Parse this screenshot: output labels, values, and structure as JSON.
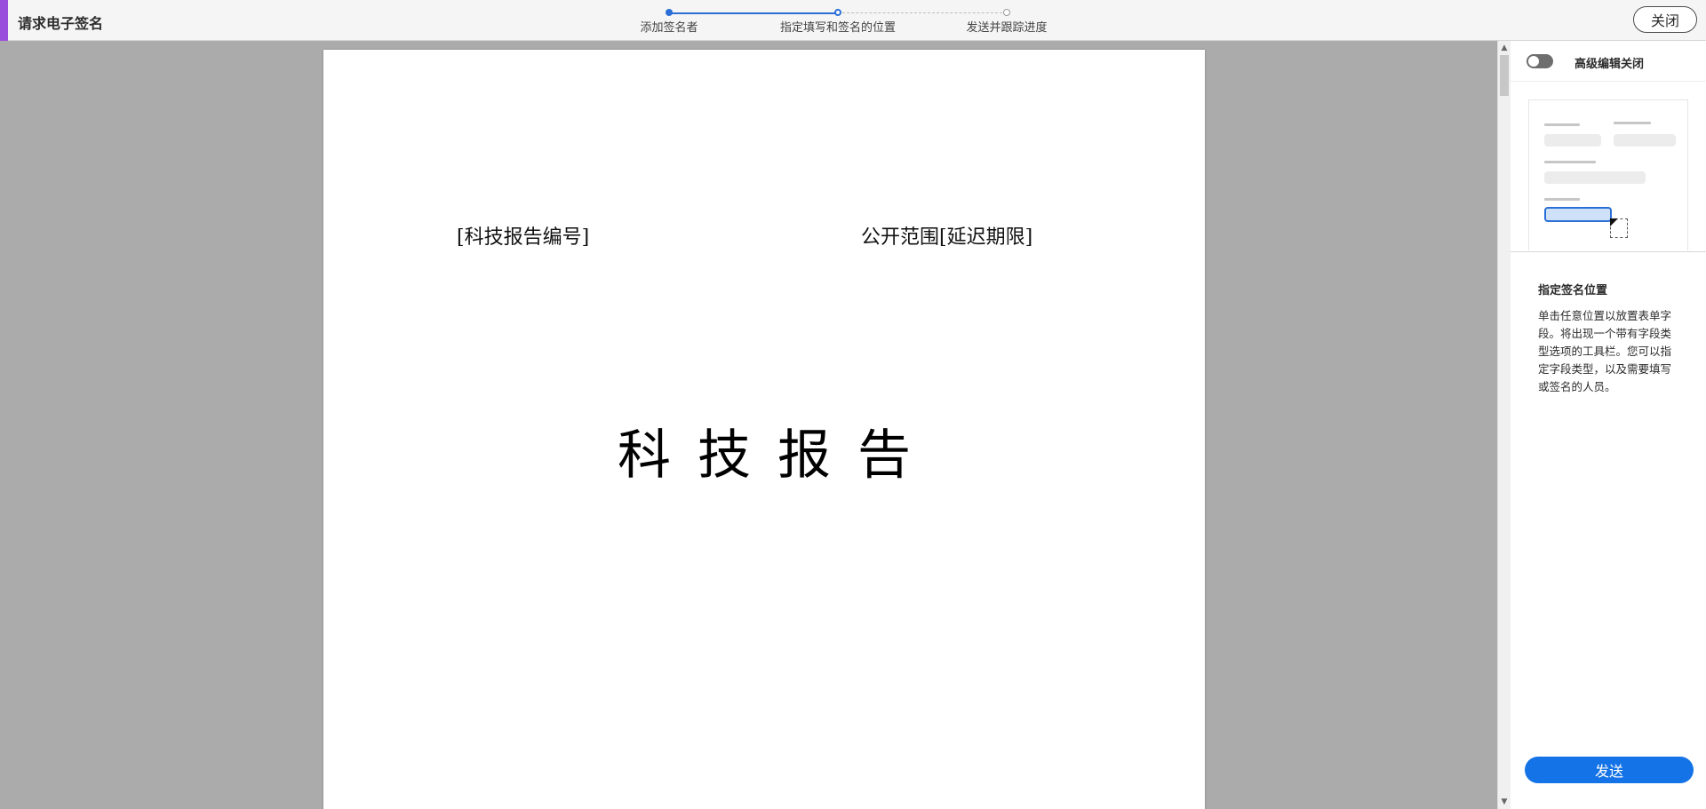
{
  "app": {
    "title": "请求电子签名",
    "accent_color": "#9a4fdc"
  },
  "stepper": {
    "steps": [
      {
        "label": "添加签名者",
        "status": "completed"
      },
      {
        "label": "指定填写和签名的位置",
        "status": "current"
      },
      {
        "label": "发送并跟踪进度",
        "status": "pending"
      }
    ],
    "progress_color": "#2b6fd6"
  },
  "header": {
    "close_label": "关闭"
  },
  "document": {
    "header_left": "[科技报告编号]",
    "header_right": "公开范围[延迟期限]",
    "title": "科技报告"
  },
  "panel": {
    "toggle_label": "高级编辑关闭",
    "toggle_state": "off",
    "help_title": "指定签名位置",
    "help_text": "单击任意位置以放置表单字段。将出现一个带有字段类型选项的工具栏。您可以指定字段类型，以及需要填写或签名的人员。",
    "send_label": "发送",
    "send_color": "#1473e6"
  }
}
